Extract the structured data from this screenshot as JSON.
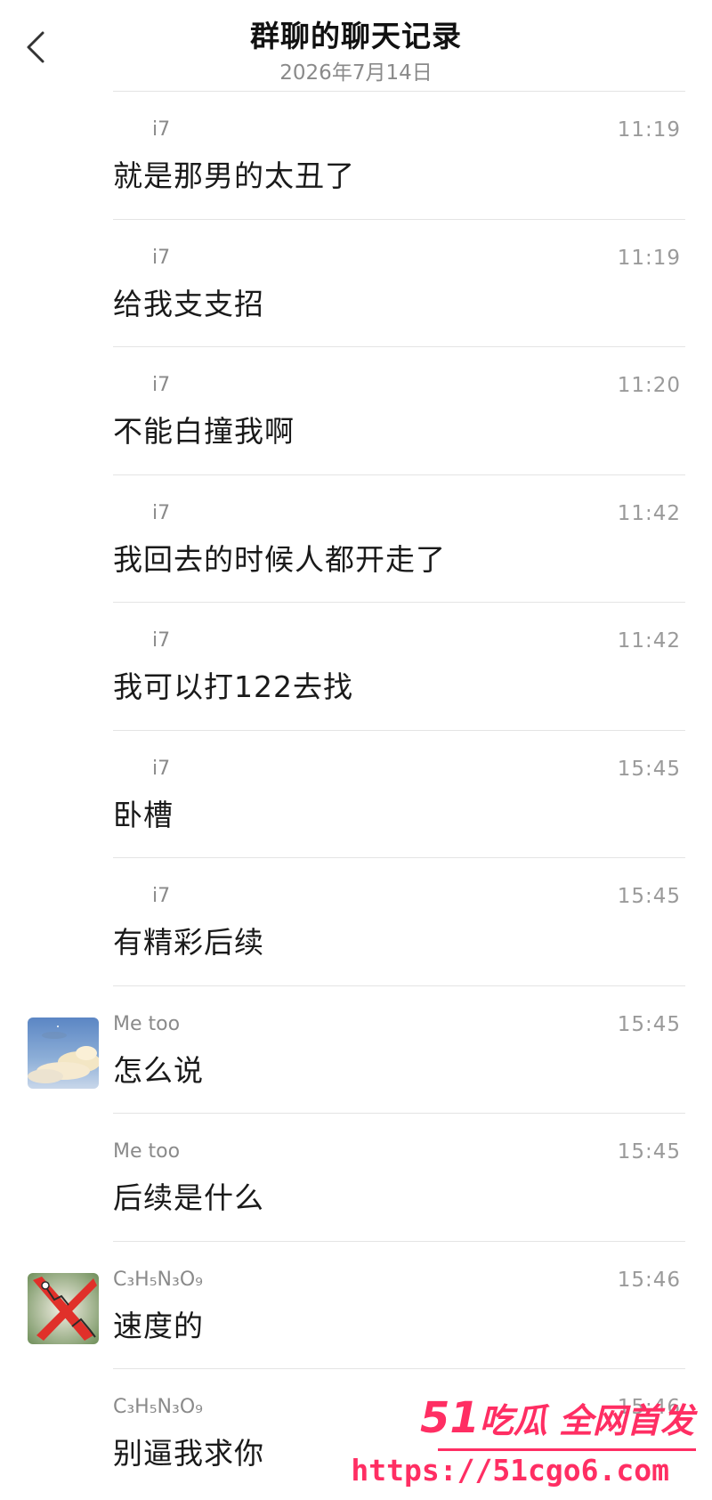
{
  "header": {
    "title": "群聊的聊天记录",
    "date": "2026年7月14日"
  },
  "messages": [
    {
      "sender": "i7",
      "time": "11:19",
      "text": "就是那男的太丑了"
    },
    {
      "sender": "i7",
      "time": "11:19",
      "text": "给我支支招"
    },
    {
      "sender": "i7",
      "time": "11:20",
      "text": "不能白撞我啊"
    },
    {
      "sender": "i7",
      "time": "11:42",
      "text": "我回去的时候人都开走了"
    },
    {
      "sender": "i7",
      "time": "11:42",
      "text": "我可以打122去找"
    },
    {
      "sender": "i7",
      "time": "15:45",
      "text": "卧槽"
    },
    {
      "sender": "i7",
      "time": "15:45",
      "text": "有精彩后续"
    },
    {
      "sender": "Me too",
      "time": "15:45",
      "text": "怎么说"
    },
    {
      "sender": "Me too",
      "time": "15:45",
      "text": "后续是什么"
    },
    {
      "sender": "C₃H₅N₃O₉",
      "time": "15:46",
      "text": "速度的"
    },
    {
      "sender": "C₃H₅N₃O₉",
      "time": "15:46",
      "text": "别逼我求你"
    }
  ],
  "watermark": {
    "number": "51",
    "tagline": "吃瓜 全网首发",
    "url": "https://51cgo6.com"
  },
  "colors": {
    "watermark": "#ff2e63",
    "divider": "#e4e4e4",
    "secondary_text": "#8a8a8a"
  }
}
